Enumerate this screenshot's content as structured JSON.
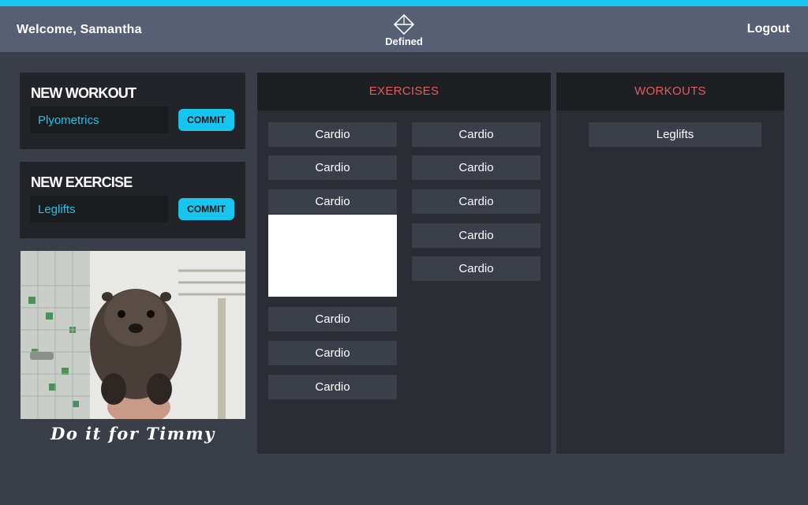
{
  "header": {
    "welcome": "Welcome, Samantha",
    "logo_text": "Defined",
    "logout": "Logout"
  },
  "new_workout": {
    "title": "NEW WORKOUT",
    "input_value": "Plyometrics",
    "commit_label": "COMMIT"
  },
  "new_exercise": {
    "title": "NEW EXERCISE",
    "input_value": "Leglifts",
    "commit_label": "COMMIT"
  },
  "motivation": {
    "caption": "Do it for Timmy"
  },
  "exercises": {
    "title": "EXERCISES",
    "left_column": [
      "Cardio",
      "Cardio",
      "Cardio",
      "Cardio",
      "Cardio",
      "Cardio"
    ],
    "right_column": [
      "Cardio",
      "Cardio",
      "Cardio",
      "Cardio",
      "Cardio"
    ]
  },
  "workouts": {
    "title": "WORKOUTS",
    "items": [
      "Leglifts"
    ]
  },
  "colors": {
    "accent": "#17c6ef",
    "header_bg": "#575f75",
    "column_title": "#e65b60"
  }
}
